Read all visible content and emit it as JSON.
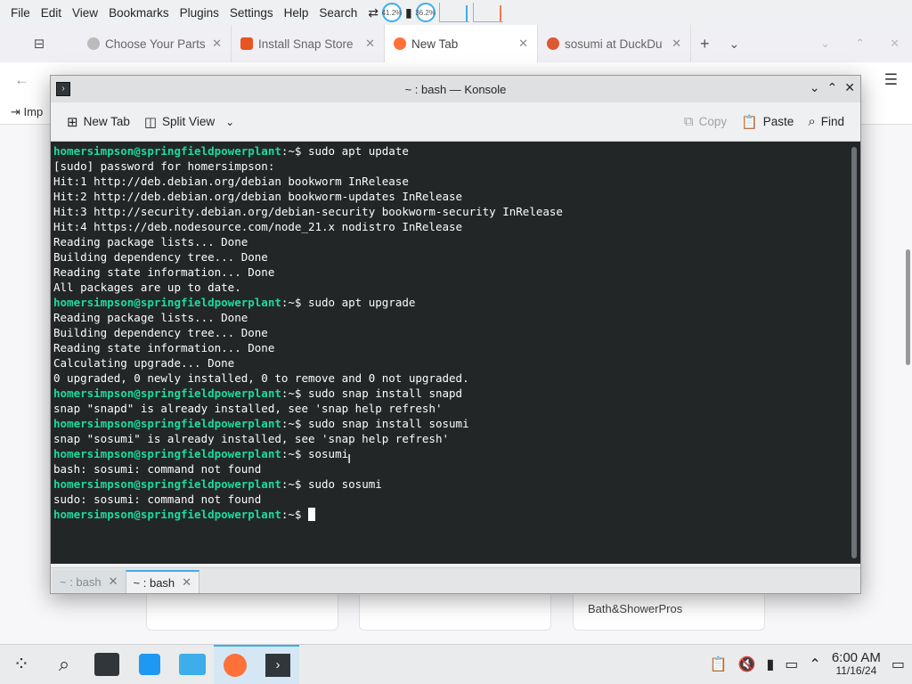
{
  "menubar": {
    "items": [
      "File",
      "Edit",
      "View",
      "Bookmarks",
      "Plugins",
      "Settings",
      "Help",
      "Search"
    ],
    "cpu_1": "41.2%",
    "cpu_2": "36.2%"
  },
  "browser": {
    "tabs": [
      {
        "label": "Choose Your Parts",
        "active": false
      },
      {
        "label": "Install Snap Store",
        "active": false
      },
      {
        "label": "New Tab",
        "active": true
      },
      {
        "label": "sosumi at DuckDu",
        "active": false
      }
    ],
    "bookmark_label": "Imp",
    "card_text": "Bath&ShowerPros"
  },
  "konsole": {
    "window_title": "~ : bash — Konsole",
    "toolbar": {
      "new_tab": "New Tab",
      "split_view": "Split View",
      "copy": "Copy",
      "paste": "Paste",
      "find": "Find"
    },
    "prompt": "homersimpson@springfieldpowerplant",
    "prompt_suffix": ":~$ ",
    "lines": [
      {
        "type": "cmd",
        "text": "sudo apt update"
      },
      {
        "type": "out",
        "text": "[sudo] password for homersimpson:"
      },
      {
        "type": "out",
        "text": "Hit:1 http://deb.debian.org/debian bookworm InRelease"
      },
      {
        "type": "out",
        "text": "Hit:2 http://deb.debian.org/debian bookworm-updates InRelease"
      },
      {
        "type": "out",
        "text": "Hit:3 http://security.debian.org/debian-security bookworm-security InRelease"
      },
      {
        "type": "out",
        "text": "Hit:4 https://deb.nodesource.com/node_21.x nodistro InRelease"
      },
      {
        "type": "out",
        "text": "Reading package lists... Done"
      },
      {
        "type": "out",
        "text": "Building dependency tree... Done"
      },
      {
        "type": "out",
        "text": "Reading state information... Done"
      },
      {
        "type": "out",
        "text": "All packages are up to date."
      },
      {
        "type": "cmd",
        "text": "sudo apt upgrade"
      },
      {
        "type": "out",
        "text": "Reading package lists... Done"
      },
      {
        "type": "out",
        "text": "Building dependency tree... Done"
      },
      {
        "type": "out",
        "text": "Reading state information... Done"
      },
      {
        "type": "out",
        "text": "Calculating upgrade... Done"
      },
      {
        "type": "out",
        "text": "0 upgraded, 0 newly installed, 0 to remove and 0 not upgraded."
      },
      {
        "type": "cmd",
        "text": "sudo snap install snapd"
      },
      {
        "type": "out",
        "text": "snap \"snapd\" is already installed, see 'snap help refresh'"
      },
      {
        "type": "cmd",
        "text": "sudo snap install sosumi"
      },
      {
        "type": "out",
        "text": "snap \"sosumi\" is already installed, see 'snap help refresh'"
      },
      {
        "type": "cmd",
        "text": "sosumi"
      },
      {
        "type": "out",
        "text": "bash: sosumi: command not found"
      },
      {
        "type": "cmd",
        "text": "sudo sosumi"
      },
      {
        "type": "out",
        "text": "sudo: sosumi: command not found"
      },
      {
        "type": "cursor",
        "text": ""
      }
    ],
    "tabs": [
      {
        "label": "~ : bash",
        "active": false
      },
      {
        "label": "~ : bash",
        "active": true
      }
    ]
  },
  "taskbar": {
    "time": "6:00 AM",
    "date": "11/16/24"
  },
  "colors": {
    "terminal_bg": "#232627",
    "prompt_green": "#1cdc9a",
    "accent": "#3daee9"
  }
}
